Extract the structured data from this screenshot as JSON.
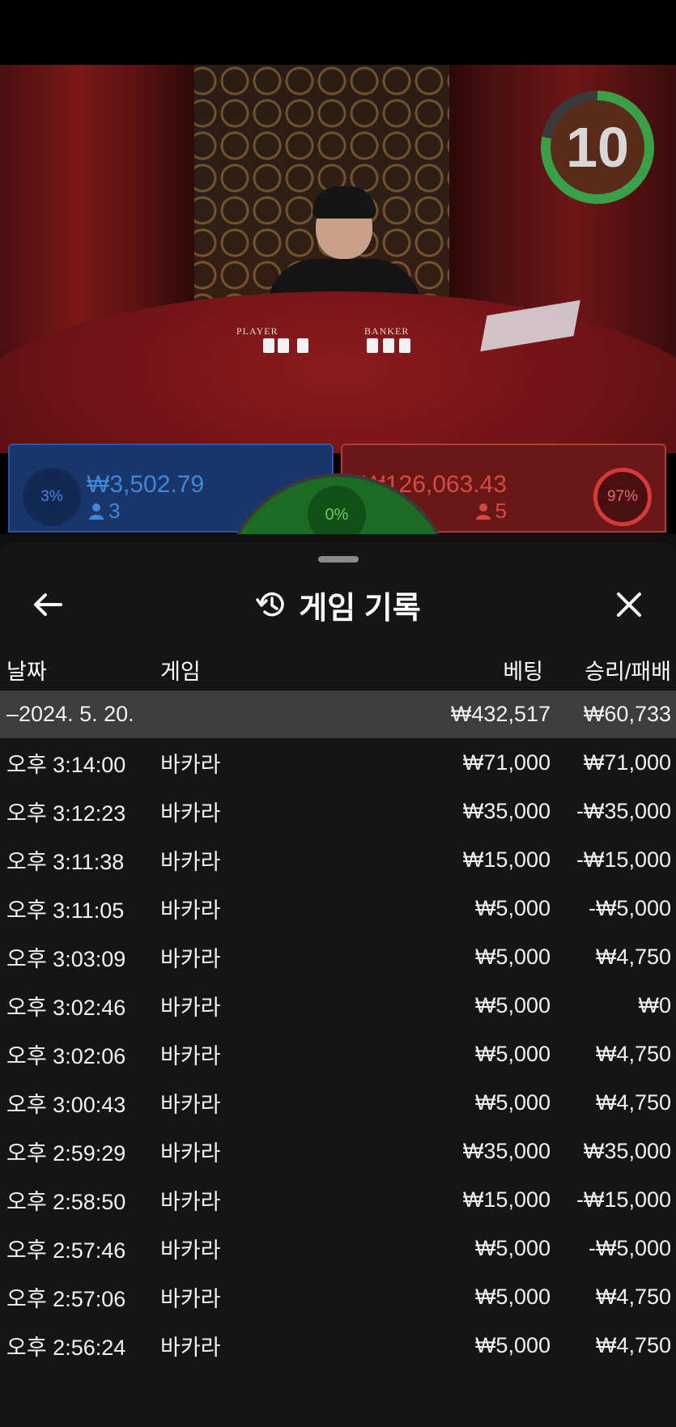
{
  "game_view": {
    "timer_value": "10",
    "table_labels": {
      "player": "PLAYER",
      "banker": "BANKER"
    }
  },
  "bets": {
    "player": {
      "percent": "3%",
      "amount": "₩3,502.79",
      "players": "3"
    },
    "tie": {
      "percent": "0%"
    },
    "banker": {
      "percent": "97%",
      "amount": "₩126,063.43",
      "players": "5"
    }
  },
  "history_sheet": {
    "title": "게임 기록",
    "columns": {
      "date": "날짜",
      "game": "게임",
      "bet": "베팅",
      "result": "승리/패배"
    },
    "summary": {
      "date": "–2024. 5. 20.",
      "bet": "₩432,517",
      "result": "₩60,733"
    },
    "rows": [
      {
        "time": "오후 3:14:00",
        "game": "바카라",
        "bet": "₩71,000",
        "result": "₩71,000"
      },
      {
        "time": "오후 3:12:23",
        "game": "바카라",
        "bet": "₩35,000",
        "result": "-₩35,000"
      },
      {
        "time": "오후 3:11:38",
        "game": "바카라",
        "bet": "₩15,000",
        "result": "-₩15,000"
      },
      {
        "time": "오후 3:11:05",
        "game": "바카라",
        "bet": "₩5,000",
        "result": "-₩5,000"
      },
      {
        "time": "오후 3:03:09",
        "game": "바카라",
        "bet": "₩5,000",
        "result": "₩4,750"
      },
      {
        "time": "오후 3:02:46",
        "game": "바카라",
        "bet": "₩5,000",
        "result": "₩0"
      },
      {
        "time": "오후 3:02:06",
        "game": "바카라",
        "bet": "₩5,000",
        "result": "₩4,750"
      },
      {
        "time": "오후 3:00:43",
        "game": "바카라",
        "bet": "₩5,000",
        "result": "₩4,750"
      },
      {
        "time": "오후 2:59:29",
        "game": "바카라",
        "bet": "₩35,000",
        "result": "₩35,000"
      },
      {
        "time": "오후 2:58:50",
        "game": "바카라",
        "bet": "₩15,000",
        "result": "-₩15,000"
      },
      {
        "time": "오후 2:57:46",
        "game": "바카라",
        "bet": "₩5,000",
        "result": "-₩5,000"
      },
      {
        "time": "오후 2:57:06",
        "game": "바카라",
        "bet": "₩5,000",
        "result": "₩4,750"
      },
      {
        "time": "오후 2:56:24",
        "game": "바카라",
        "bet": "₩5,000",
        "result": "₩4,750"
      }
    ]
  },
  "icons": {
    "back": "arrow-left-icon",
    "history": "history-clock-icon",
    "close": "close-icon",
    "user": "user-icon"
  },
  "colors": {
    "player": "#3f88d8",
    "banker": "#d43a3a",
    "tie": "#1d6a24",
    "timer": "#3aa048"
  }
}
